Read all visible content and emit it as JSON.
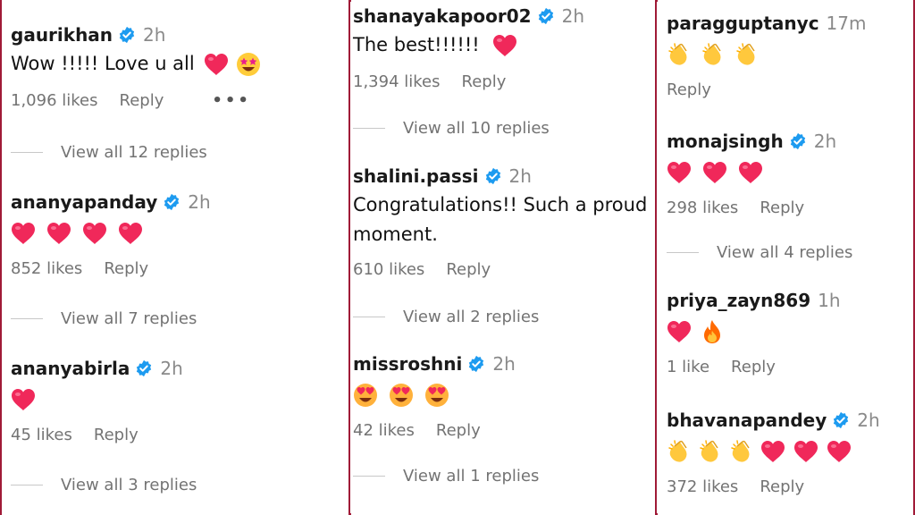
{
  "colors": {
    "accent_border": "#a01a37",
    "verified_blue": "#1d9bf0",
    "heart_red": "#f0285a",
    "muted_text": "#737373"
  },
  "panels": [
    {
      "comments": [
        {
          "username": "gaurikhan",
          "time": "2h",
          "text": "Wow !!!!! Love u all",
          "emojis": [
            "red-heart",
            "star-struck"
          ],
          "likes": "1,096 likes",
          "reply": "Reply",
          "more": "•••",
          "view_replies": "View all 12 replies"
        },
        {
          "username": "ananyapanday",
          "time": "2h",
          "emojis": [
            "red-heart",
            "red-heart",
            "red-heart",
            "red-heart"
          ],
          "likes": "852 likes",
          "reply": "Reply",
          "view_replies": "View all 7 replies"
        },
        {
          "username": "ananyabirla",
          "time": "2h",
          "emojis": [
            "red-heart"
          ],
          "likes": "45 likes",
          "reply": "Reply",
          "view_replies": "View all 3 replies"
        }
      ]
    },
    {
      "comments": [
        {
          "username": "shanayakapoor02",
          "time": "2h",
          "text": "The best!!!!!!",
          "emojis": [
            "red-heart"
          ],
          "likes": "1,394 likes",
          "reply": "Reply",
          "view_replies": "View all 10 replies"
        },
        {
          "username": "shalini.passi",
          "time": "2h",
          "text": "Congratulations!! Such a proud moment.",
          "likes": "610 likes",
          "reply": "Reply",
          "view_replies": "View all 2 replies"
        },
        {
          "username": "missroshni",
          "time": "2h",
          "emojis": [
            "heart-eyes",
            "heart-eyes",
            "heart-eyes"
          ],
          "likes": "42 likes",
          "reply": "Reply",
          "view_replies": "View all 1 replies"
        }
      ]
    },
    {
      "comments": [
        {
          "username": "paragguptanyc",
          "time": "17m",
          "emojis": [
            "clapping-hands",
            "clapping-hands",
            "clapping-hands"
          ],
          "reply": "Reply"
        },
        {
          "username": "monajsingh",
          "time": "2h",
          "emojis": [
            "red-heart",
            "red-heart",
            "red-heart"
          ],
          "likes": "298 likes",
          "reply": "Reply",
          "view_replies": "View all 4 replies"
        },
        {
          "username": "priya_zayn869",
          "time": "1h",
          "emojis": [
            "red-heart",
            "fire"
          ],
          "likes": "1 like",
          "reply": "Reply"
        },
        {
          "username": "bhavanapandey",
          "time": "2h",
          "emojis": [
            "clapping-hands",
            "clapping-hands",
            "clapping-hands",
            "red-heart",
            "red-heart",
            "red-heart"
          ],
          "likes": "372 likes",
          "reply": "Reply"
        }
      ]
    }
  ]
}
